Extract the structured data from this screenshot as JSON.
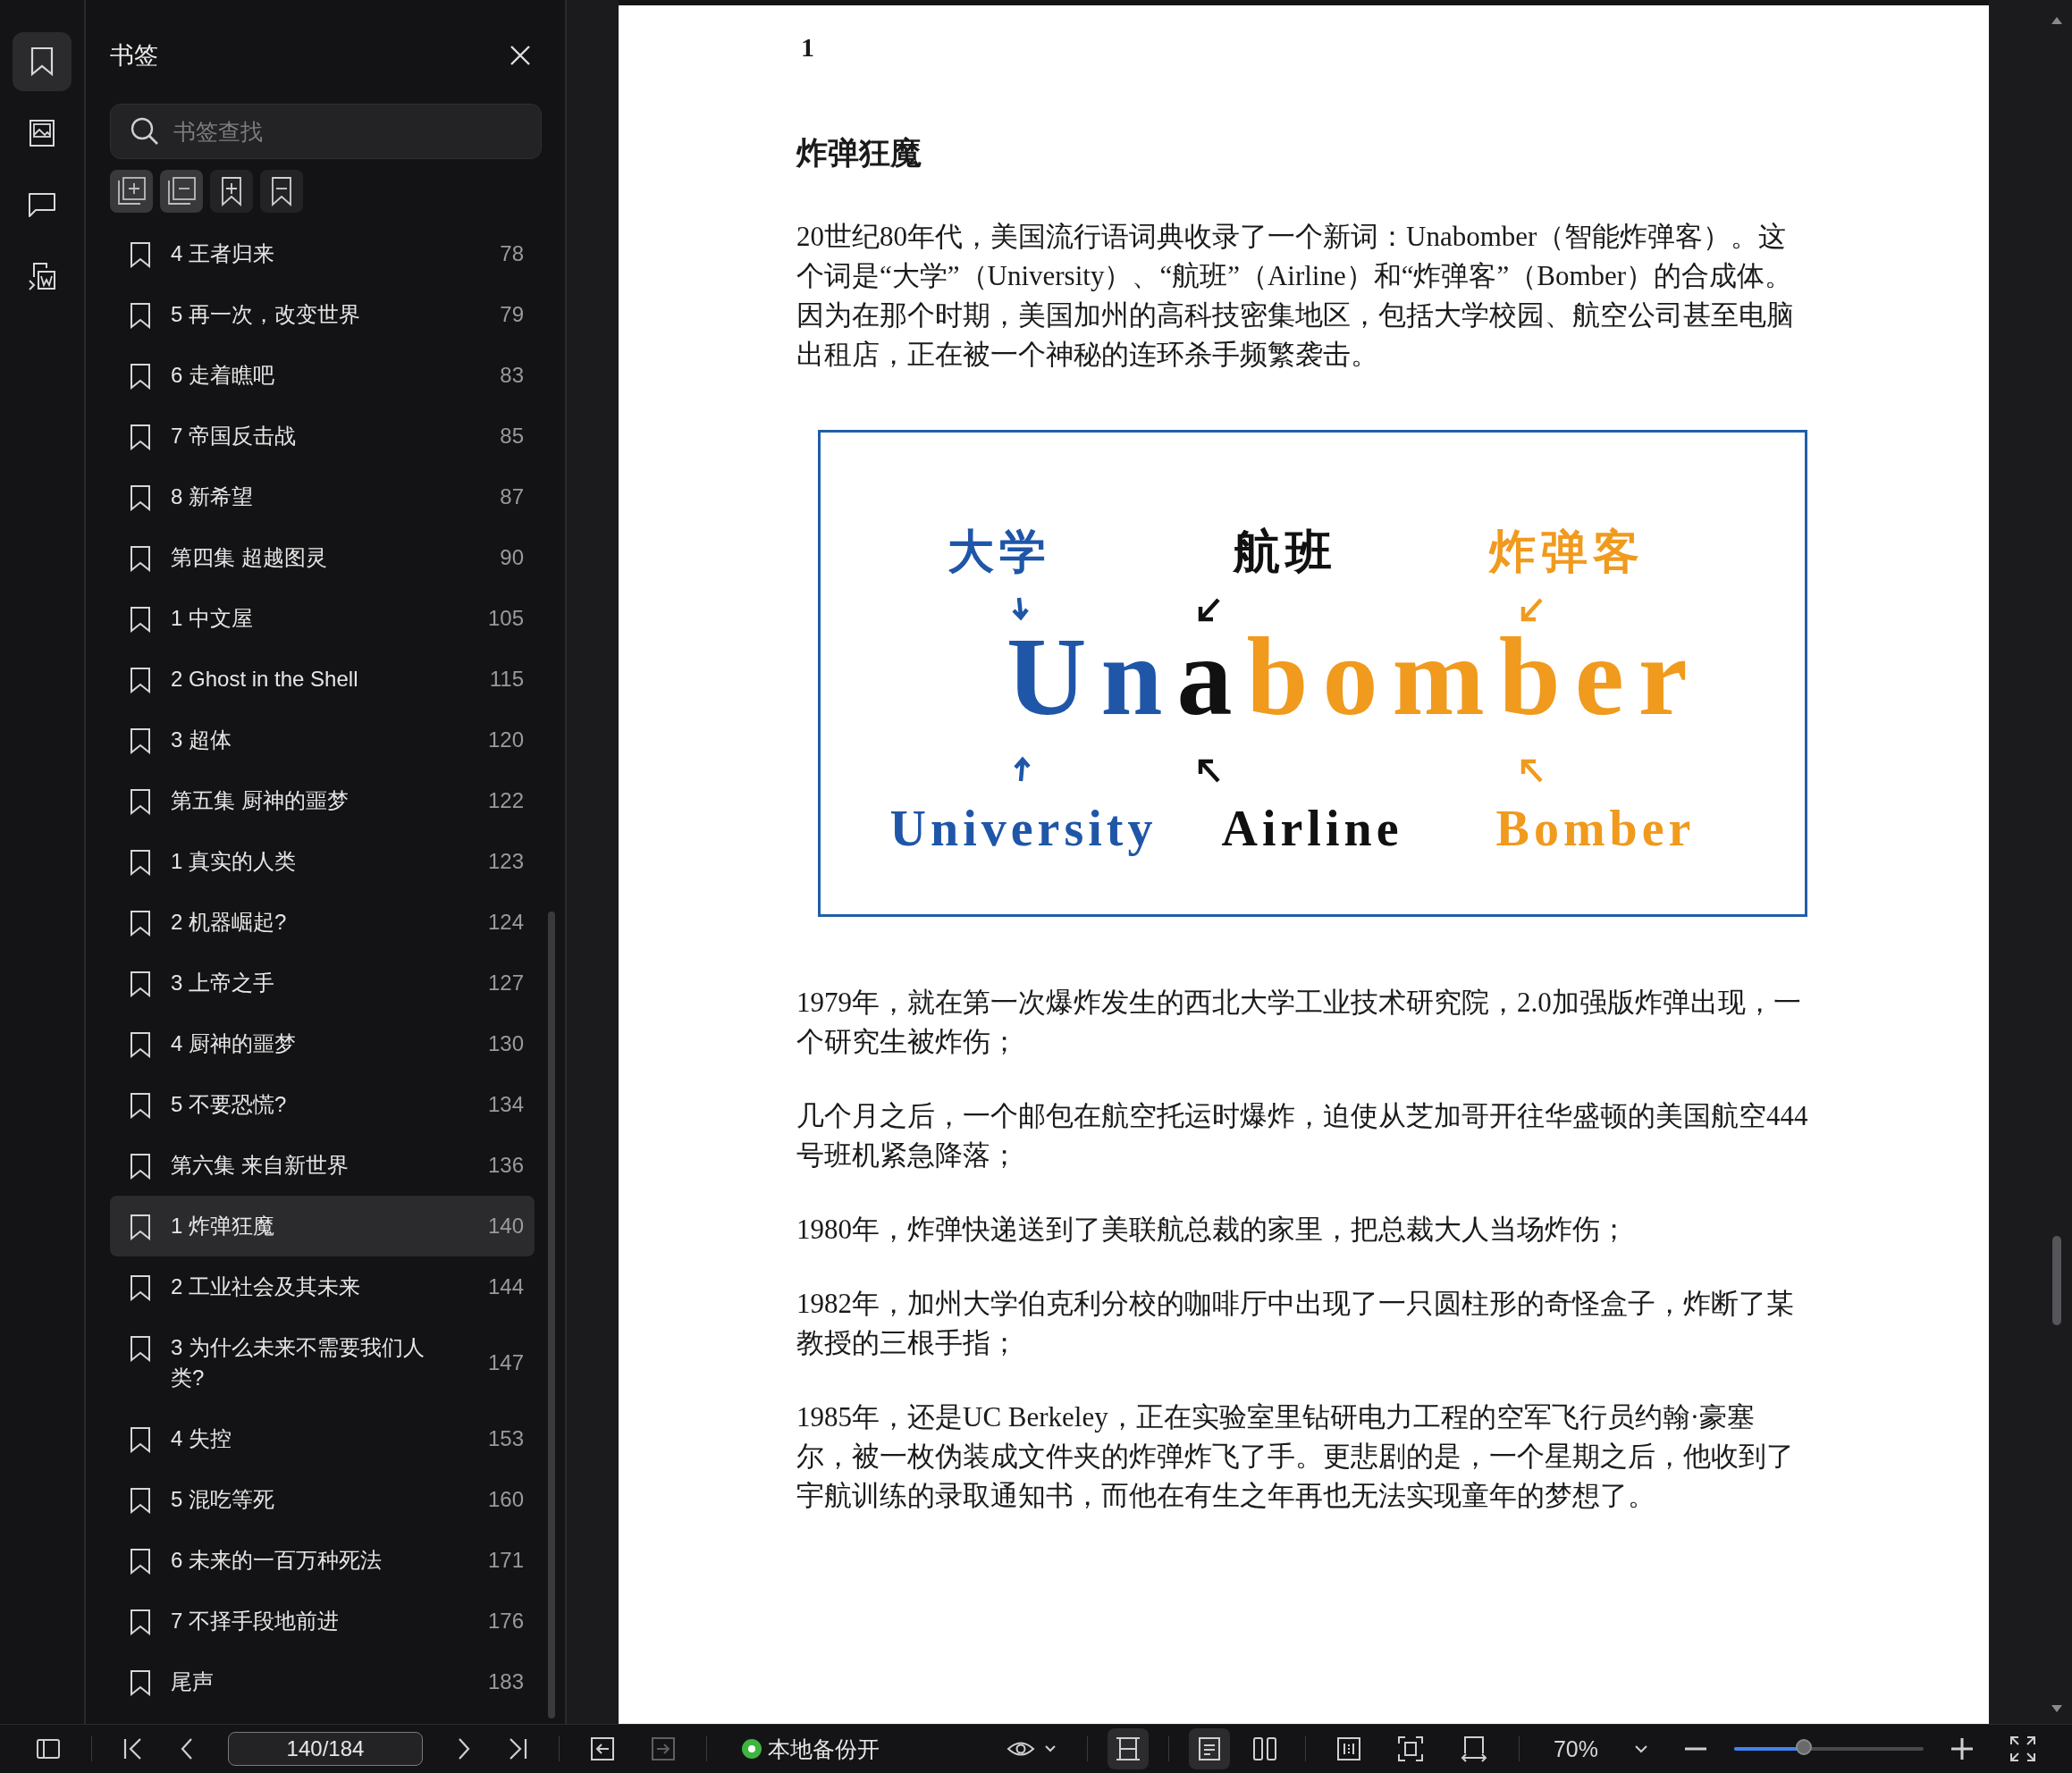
{
  "rail": [
    {
      "kind": "bookmarks",
      "selected": true
    },
    {
      "kind": "images",
      "selected": false
    },
    {
      "kind": "comments",
      "selected": false
    },
    {
      "kind": "thumbnails",
      "selected": false
    }
  ],
  "sidebar": {
    "title": "书签",
    "search": {
      "placeholder": "书签查找"
    },
    "bookmarks": [
      {
        "title": "4 王者归来",
        "page": "78",
        "selected": false
      },
      {
        "title": "5 再一次，改变世界",
        "page": "79",
        "selected": false
      },
      {
        "title": "6 走着瞧吧",
        "page": "83",
        "selected": false
      },
      {
        "title": "7 帝国反击战",
        "page": "85",
        "selected": false
      },
      {
        "title": "8 新希望",
        "page": "87",
        "selected": false
      },
      {
        "title": "第四集 超越图灵",
        "page": "90",
        "selected": false
      },
      {
        "title": "1 中文屋",
        "page": "105",
        "selected": false
      },
      {
        "title": "2 Ghost in the Shell",
        "page": "115",
        "selected": false
      },
      {
        "title": "3 超体",
        "page": "120",
        "selected": false
      },
      {
        "title": "第五集 厨神的噩梦",
        "page": "122",
        "selected": false
      },
      {
        "title": "1 真实的人类",
        "page": "123",
        "selected": false
      },
      {
        "title": "2 机器崛起?",
        "page": "124",
        "selected": false
      },
      {
        "title": "3 上帝之手",
        "page": "127",
        "selected": false
      },
      {
        "title": "4 厨神的噩梦",
        "page": "130",
        "selected": false
      },
      {
        "title": "5 不要恐慌?",
        "page": "134",
        "selected": false
      },
      {
        "title": "第六集 来自新世界",
        "page": "136",
        "selected": false
      },
      {
        "title": "1 炸弹狂魔",
        "page": "140",
        "selected": true
      },
      {
        "title": "2 工业社会及其未来",
        "page": "144",
        "selected": false
      },
      {
        "title": "3 为什么未来不需要我们人类?",
        "page": "147",
        "selected": false
      },
      {
        "title": "4 失控",
        "page": "153",
        "selected": false
      },
      {
        "title": "5 混吃等死",
        "page": "160",
        "selected": false
      },
      {
        "title": "6 未来的一百万种死法",
        "page": "171",
        "selected": false
      },
      {
        "title": "7 不择手段地前进",
        "page": "176",
        "selected": false
      },
      {
        "title": "尾声",
        "page": "183",
        "selected": false
      }
    ]
  },
  "page": {
    "number": "1",
    "heading": "炸弹狂魔",
    "intro": "20世纪80年代，美国流行语词典收录了一个新词：Unabomber（智能炸弹客）。这个词是“大学”（University）、“航班”（Airline）和“炸弹客”（Bomber）的合成体。因为在那个时期，美国加州的高科技密集地区，包括大学校园、航空公司甚至电脑出租店，正在被一个神秘的连环杀手频繁袭击。",
    "figure": {
      "top_labels": [
        {
          "text": "大学",
          "color": "#1f56a8"
        },
        {
          "text": "航班",
          "color": "#111111"
        },
        {
          "text": "炸弹客",
          "color": "#f09a1e"
        }
      ],
      "word_parts": [
        {
          "text": "Un",
          "color": "#1f56a8"
        },
        {
          "text": "a",
          "color": "#111111"
        },
        {
          "text": "bomber",
          "color": "#f09a1e"
        }
      ],
      "bottom_labels": [
        {
          "text": "University",
          "color": "#1f56a8"
        },
        {
          "text": "Airline",
          "color": "#111111"
        },
        {
          "text": "Bomber",
          "color": "#f09a1e"
        }
      ]
    },
    "paragraphs": [
      "1979年，就在第一次爆炸发生的西北大学工业技术研究院，2.0加强版炸弹出现，一个研究生被炸伤；",
      "几个月之后，一个邮包在航空托运时爆炸，迫使从芝加哥开往华盛顿的美国航空444号班机紧急降落；",
      "1980年，炸弹快递送到了美联航总裁的家里，把总裁大人当场炸伤；",
      "1982年，加州大学伯克利分校的咖啡厅中出现了一只圆柱形的奇怪盒子，炸断了某教授的三根手指；",
      "1985年，还是UC Berkeley，正在实验室里钻研电力工程的空军飞行员约翰·豪塞尔，被一枚伪装成文件夹的炸弹炸飞了手。更悲剧的是，一个星期之后，他收到了宇航训练的录取通知书，而他在有生之年再也无法实现童年的梦想了。"
    ]
  },
  "toolbar": {
    "page_field": "140/184",
    "back": {
      "disabled": false
    },
    "forward": {
      "disabled": true
    },
    "backup": {
      "label": "本地备份开",
      "on": true
    },
    "scroll_mode": {
      "selected": true
    },
    "page_modes": [
      {
        "kind": "single",
        "selected": true
      },
      {
        "kind": "double",
        "selected": false
      }
    ],
    "zoom": {
      "value": "70%",
      "level": 0.37
    }
  }
}
